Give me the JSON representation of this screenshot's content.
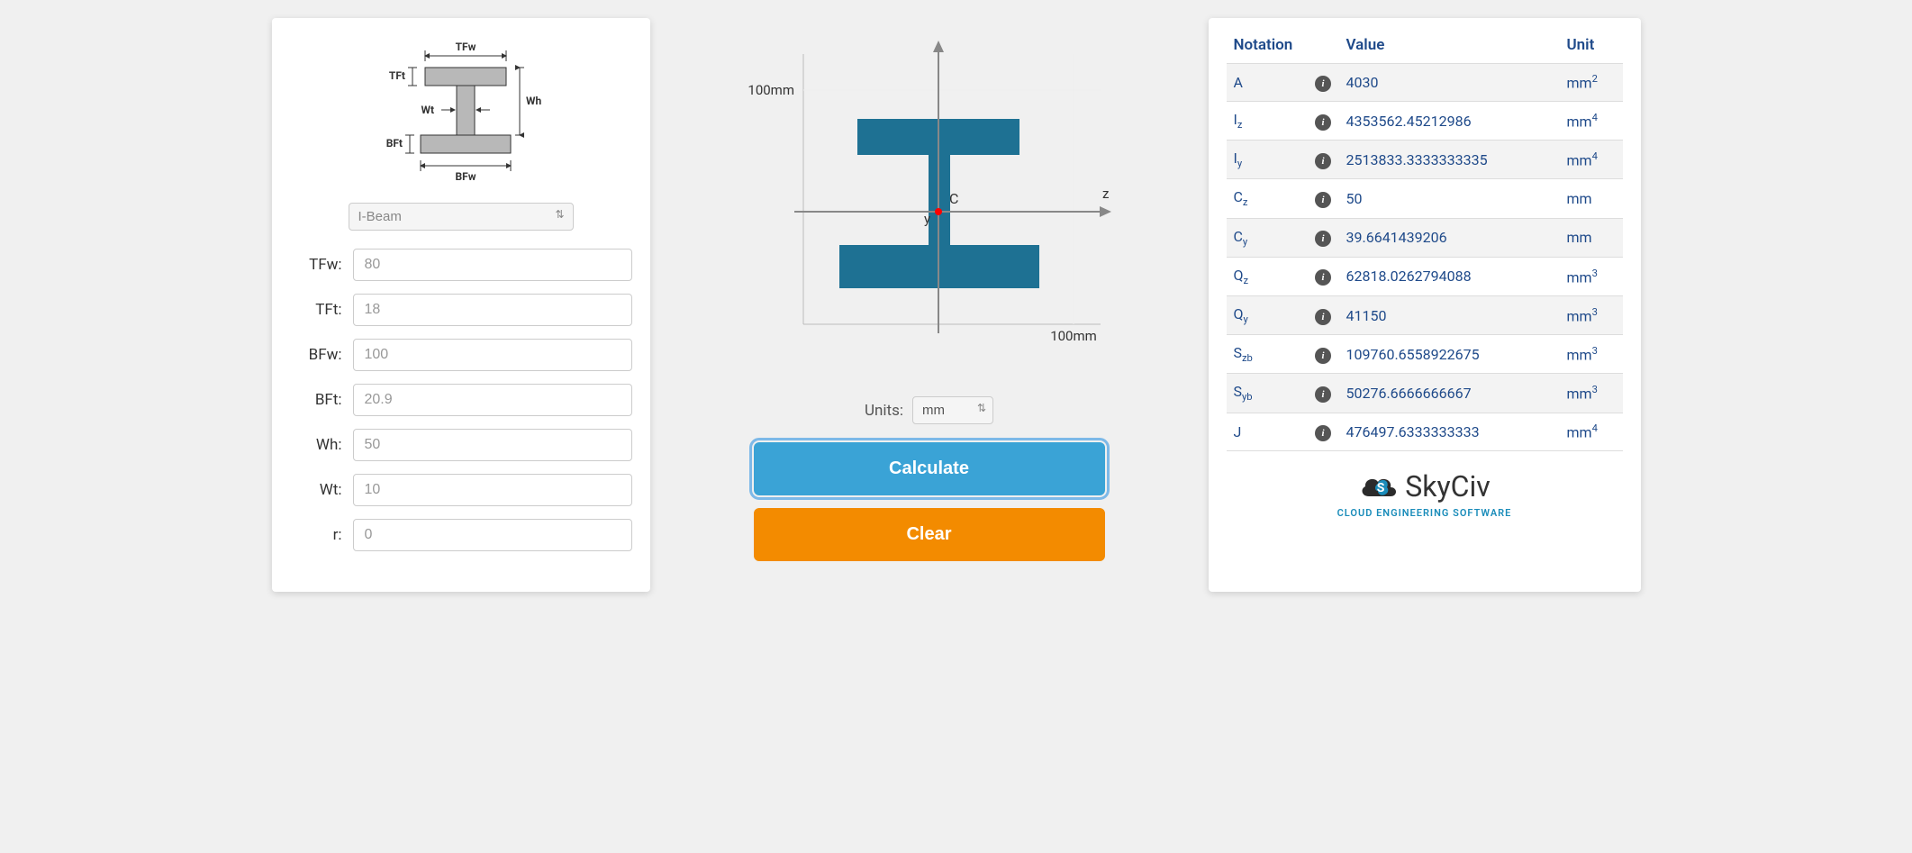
{
  "inputs": {
    "shape_selected": "I-Beam",
    "diagram_labels": {
      "TFw": "TFw",
      "TFt": "TFt",
      "Wt": "Wt",
      "Wh": "Wh",
      "BFt": "BFt",
      "BFw": "BFw"
    },
    "fields": [
      {
        "label": "TFw:",
        "value": "80"
      },
      {
        "label": "TFt:",
        "value": "18"
      },
      {
        "label": "BFw:",
        "value": "100"
      },
      {
        "label": "BFt:",
        "value": "20.9"
      },
      {
        "label": "Wh:",
        "value": "50"
      },
      {
        "label": "Wt:",
        "value": "10"
      },
      {
        "label": "r:",
        "value": "0"
      }
    ]
  },
  "middle": {
    "units_label": "Units:",
    "units_value": "mm",
    "calc_label": "Calculate",
    "clear_label": "Clear",
    "plot": {
      "x_tick": "100mm",
      "y_tick": "100mm",
      "c_label": "C",
      "y_label": "y",
      "z_label": "z"
    }
  },
  "results": {
    "headers": {
      "notation": "Notation",
      "value": "Value",
      "unit": "Unit"
    },
    "rows": [
      {
        "notation_html": "A",
        "value": "4030",
        "unit_html": "mm<sup>2</sup>"
      },
      {
        "notation_html": "I<sub>z</sub>",
        "value": "4353562.45212986",
        "unit_html": "mm<sup>4</sup>"
      },
      {
        "notation_html": "I<sub>y</sub>",
        "value": "2513833.3333333335",
        "unit_html": "mm<sup>4</sup>"
      },
      {
        "notation_html": "C<sub>z</sub>",
        "value": "50",
        "unit_html": "mm"
      },
      {
        "notation_html": "C<sub>y</sub>",
        "value": "39.6641439206",
        "unit_html": "mm"
      },
      {
        "notation_html": "Q<sub>z</sub>",
        "value": "62818.0262794088",
        "unit_html": "mm<sup>3</sup>"
      },
      {
        "notation_html": "Q<sub>y</sub>",
        "value": "41150",
        "unit_html": "mm<sup>3</sup>"
      },
      {
        "notation_html": "S<sub>zb</sub>",
        "value": "109760.6558922675",
        "unit_html": "mm<sup>3</sup>"
      },
      {
        "notation_html": "S<sub>yb</sub>",
        "value": "50276.6666666667",
        "unit_html": "mm<sup>3</sup>"
      },
      {
        "notation_html": "J",
        "value": "476497.6333333333",
        "unit_html": "mm<sup>4</sup>"
      }
    ]
  },
  "logo": {
    "name": "SkyCiv",
    "tagline": "CLOUD ENGINEERING SOFTWARE"
  }
}
